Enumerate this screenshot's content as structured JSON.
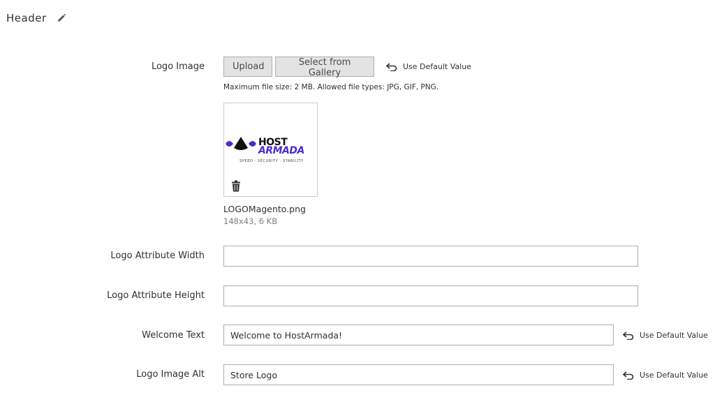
{
  "section": {
    "title": "Header"
  },
  "logo_image": {
    "label": "Logo Image",
    "upload_label": "Upload",
    "gallery_label": "Select from Gallery",
    "use_default_label": "Use Default Value",
    "note": "Maximum file size: 2 MB. Allowed file types: JPG, GIF, PNG.",
    "preview": {
      "logo_line1": "HOST",
      "logo_line2": "ARMADA",
      "logo_tagline": "SPEED · SECURITY · STABILITY"
    },
    "file_name": "LOGOMagento.png",
    "file_meta": "148x43, 6 KB"
  },
  "logo_width": {
    "label": "Logo Attribute Width",
    "value": ""
  },
  "logo_height": {
    "label": "Logo Attribute Height",
    "value": ""
  },
  "welcome_text": {
    "label": "Welcome Text",
    "value": "Welcome to HostArmada!",
    "use_default_label": "Use Default Value"
  },
  "logo_alt": {
    "label": "Logo Image Alt",
    "value": "Store Logo",
    "use_default_label": "Use Default Value"
  },
  "colors": {
    "brand_purple": "#4a2cd1",
    "button_bg": "#e3e3e3",
    "border": "#adadad"
  }
}
